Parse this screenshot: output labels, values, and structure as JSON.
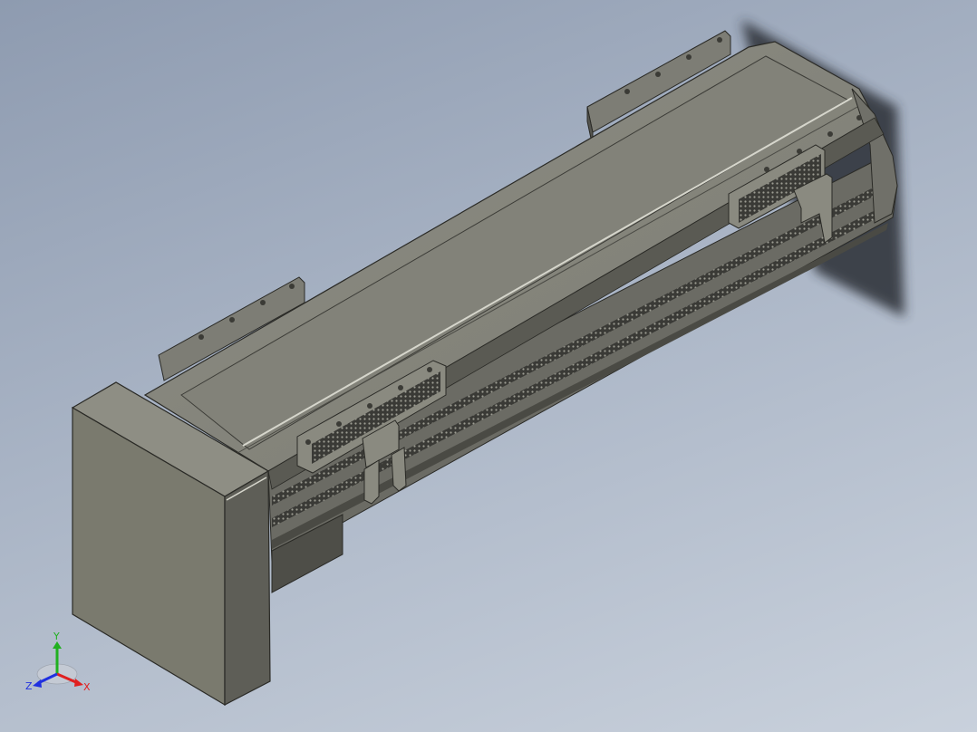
{
  "viewport": {
    "background_top": "#8e9bb0",
    "background_bottom": "#c9d1dc",
    "model_body_color": "#8a8a80",
    "model_dark_color": "#4a4a44"
  },
  "triad": {
    "x_label": "X",
    "y_label": "Y",
    "z_label": "Z",
    "x_color": "#e02020",
    "y_color": "#20b020",
    "z_color": "#2030e0"
  }
}
